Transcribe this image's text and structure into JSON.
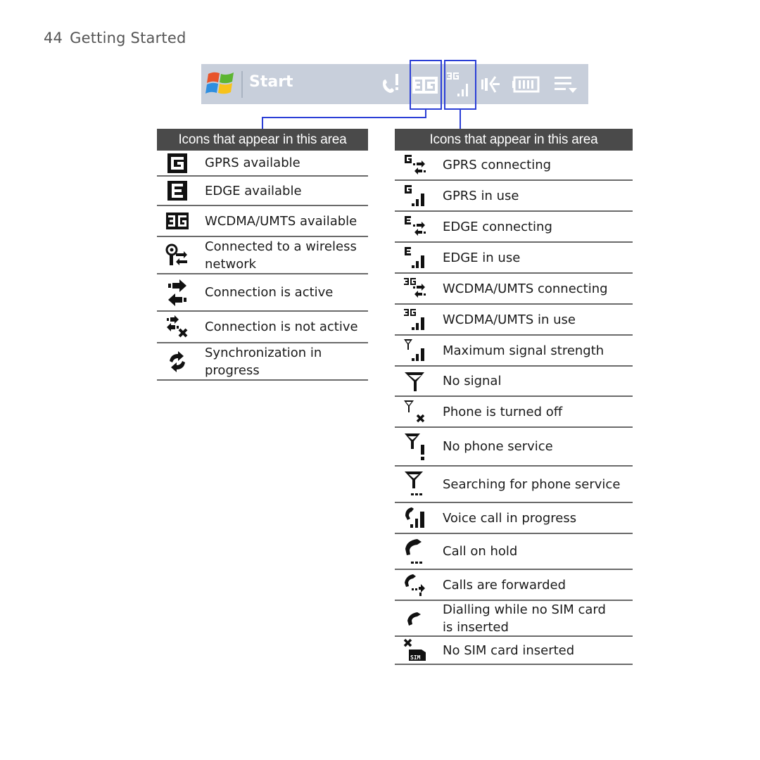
{
  "page": {
    "number": "44",
    "section": "Getting Started"
  },
  "taskbar": {
    "start_label": "Start",
    "icons": [
      "windows-logo-icon",
      "phone-alert-icon",
      "3g-available-icon",
      "3g-in-use-icon",
      "speaker-icon",
      "battery-icon",
      "menu-icon"
    ],
    "highlight_color": "#2b3fd6",
    "background": "#c8cfdb"
  },
  "left_panel": {
    "header": "Icons that appear in this area",
    "items": [
      {
        "icon": "gprs-available-icon",
        "label": "GPRS available"
      },
      {
        "icon": "edge-available-icon",
        "label": "EDGE available"
      },
      {
        "icon": "wcdma-available-icon",
        "label": "WCDMA/UMTS available"
      },
      {
        "icon": "wireless-connected-icon",
        "label": "Connected to a wireless network"
      },
      {
        "icon": "connection-active-icon",
        "label": "Connection is active"
      },
      {
        "icon": "connection-inactive-icon",
        "label": "Connection is not active"
      },
      {
        "icon": "sync-icon",
        "label": "Synchronization in progress"
      }
    ]
  },
  "right_panel": {
    "header": "Icons that appear in this area",
    "items": [
      {
        "icon": "gprs-connecting-icon",
        "label": "GPRS connecting"
      },
      {
        "icon": "gprs-in-use-icon",
        "label": "GPRS in use"
      },
      {
        "icon": "edge-connecting-icon",
        "label": "EDGE connecting"
      },
      {
        "icon": "edge-in-use-icon",
        "label": "EDGE in use"
      },
      {
        "icon": "wcdma-connecting-icon",
        "label": "WCDMA/UMTS connecting"
      },
      {
        "icon": "wcdma-in-use-icon",
        "label": "WCDMA/UMTS in use"
      },
      {
        "icon": "max-signal-icon",
        "label": "Maximum signal strength"
      },
      {
        "icon": "no-signal-icon",
        "label": "No signal"
      },
      {
        "icon": "phone-off-icon",
        "label": "Phone is turned off"
      },
      {
        "icon": "no-service-icon",
        "label": "No phone service"
      },
      {
        "icon": "searching-service-icon",
        "label": "Searching for phone service"
      },
      {
        "icon": "voice-call-icon",
        "label": "Voice call in progress"
      },
      {
        "icon": "call-hold-icon",
        "label": "Call on hold"
      },
      {
        "icon": "calls-forwarded-icon",
        "label": "Calls are forwarded"
      },
      {
        "icon": "dialling-no-sim-icon",
        "label": "Dialling while no SIM card is inserted"
      },
      {
        "icon": "no-sim-icon",
        "label": "No SIM card inserted"
      }
    ]
  }
}
